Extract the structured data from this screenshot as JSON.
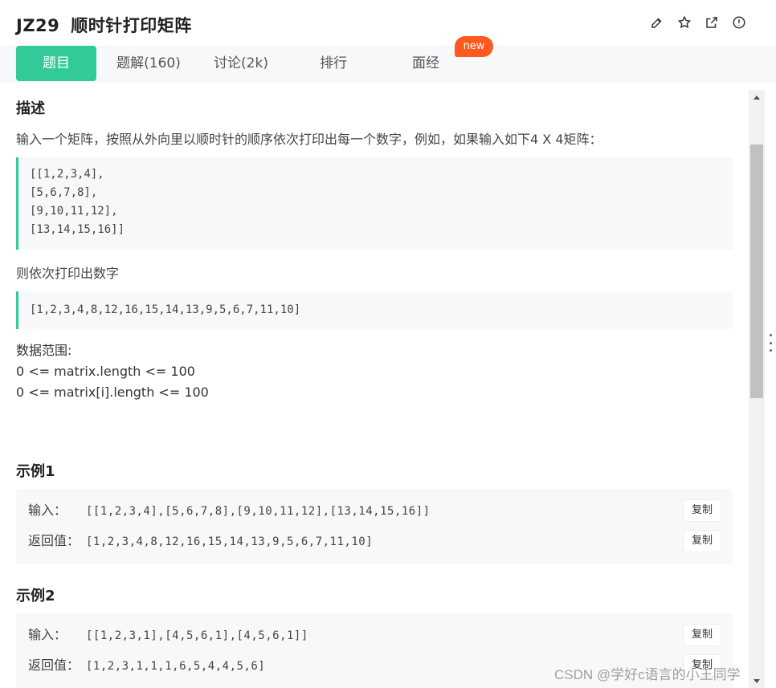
{
  "header": {
    "code": "JZ29",
    "title": "顺时针打印矩阵",
    "icons": [
      "edit-icon",
      "star-icon",
      "external-link-icon",
      "info-icon"
    ]
  },
  "tabs": [
    {
      "label": "题目",
      "active": true
    },
    {
      "label": "题解(160)",
      "active": false
    },
    {
      "label": "讨论(2k)",
      "active": false
    },
    {
      "label": "排行",
      "active": false
    },
    {
      "label": "面经",
      "active": false
    }
  ],
  "badge": "new",
  "description": {
    "heading": "描述",
    "intro": "输入一个矩阵，按照从外向里以顺时针的顺序依次打印出每一个数字，例如，如果输入如下4 X 4矩阵：",
    "matrix_lines": [
      "[[1,2,3,4],",
      "[5,6,7,8],",
      "[9,10,11,12],",
      "[13,14,15,16]]"
    ],
    "then": "则依次打印出数字",
    "output": "[1,2,3,4,8,12,16,15,14,13,9,5,6,7,11,10]",
    "range_title": "数据范围:",
    "range_1": "0 <= matrix.length <= 100",
    "range_2": "0 <= matrix[i].length <= 100"
  },
  "examples": [
    {
      "heading": "示例1",
      "input_label": "输入：",
      "input": "[[1,2,3,4],[5,6,7,8],[9,10,11,12],[13,14,15,16]]",
      "output_label": "返回值：",
      "output": "[1,2,3,4,8,12,16,15,14,13,9,5,6,7,11,10]",
      "copy": "复制"
    },
    {
      "heading": "示例2",
      "input_label": "输入：",
      "input": "[[1,2,3,1],[4,5,6,1],[4,5,6,1]]",
      "output_label": "返回值：",
      "output": "[1,2,3,1,1,1,6,5,4,4,5,6]",
      "copy": "复制"
    }
  ],
  "watermark": "CSDN @学好c语言的小王同学",
  "colors": {
    "accent": "#32ca99",
    "badge": "#fe5a1f",
    "code_bg": "#f7f8fa"
  }
}
